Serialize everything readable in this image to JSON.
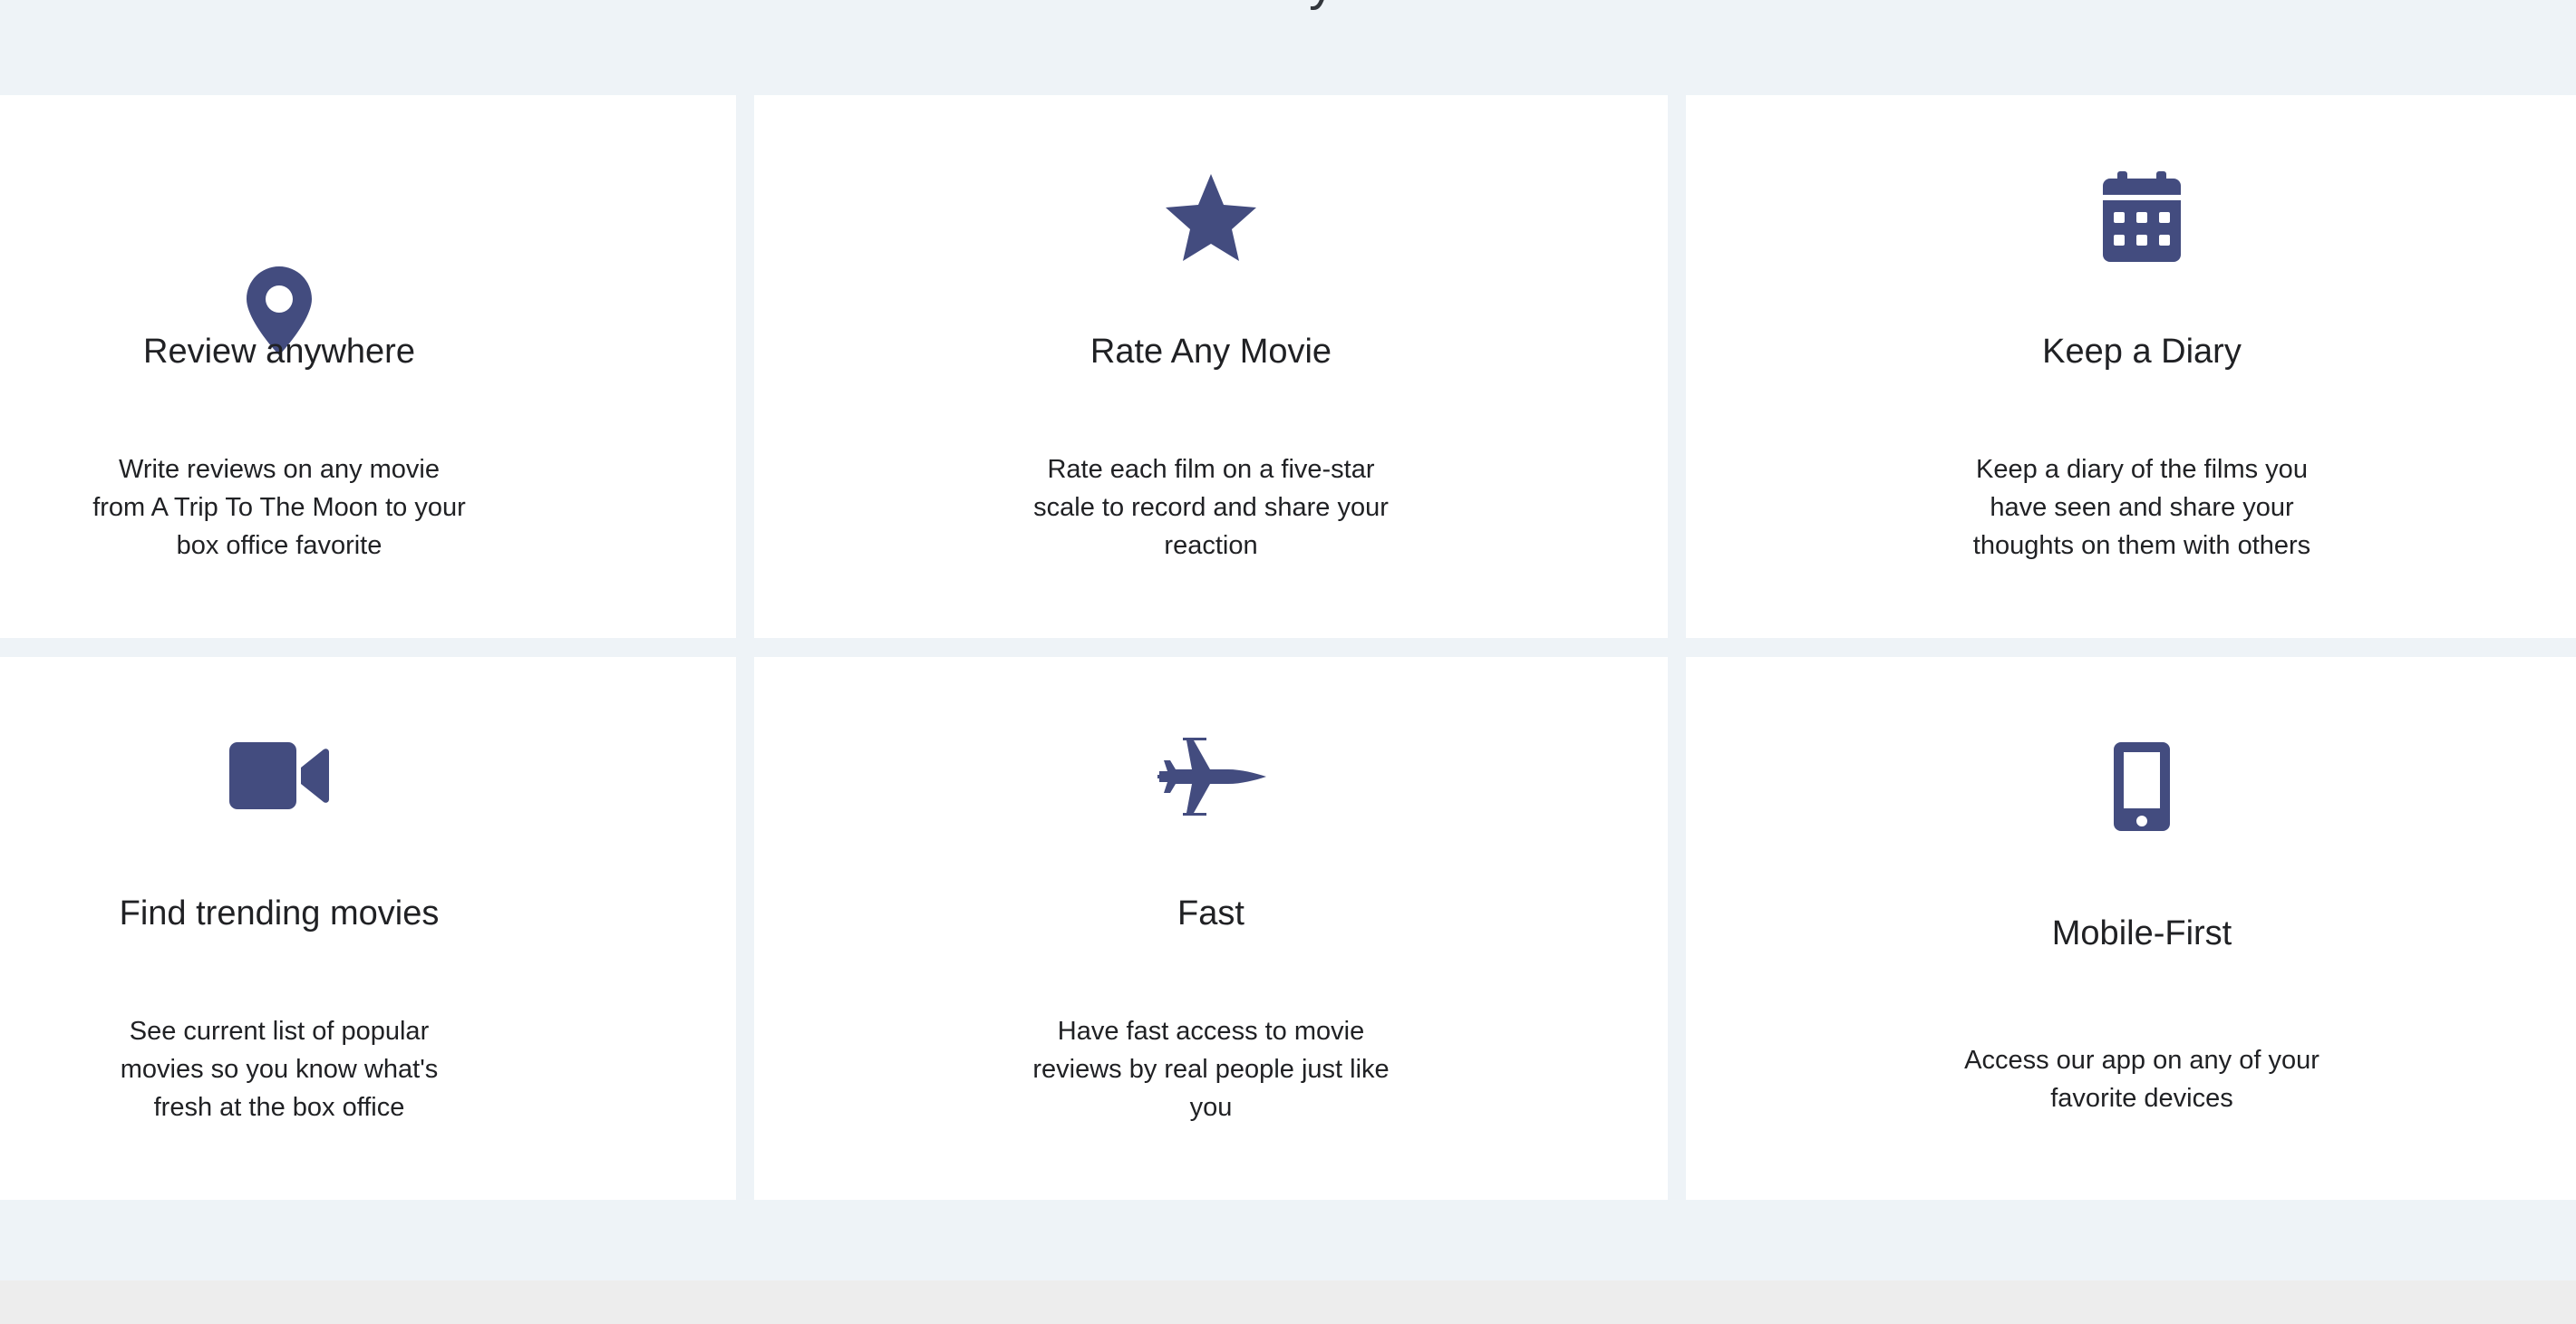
{
  "section": {
    "heading": "One Trell lets you...",
    "features": [
      {
        "icon": "map-marker-icon",
        "title": "Review anywhere",
        "description": "Write reviews on any movie from A Trip To The Moon to your box office favorite"
      },
      {
        "icon": "star-icon",
        "title": "Rate Any Movie",
        "description": "Rate each film on a five-star scale to record and share your reaction"
      },
      {
        "icon": "calendar-icon",
        "title": "Keep a Diary",
        "description": "Keep a diary of the films you have seen and share your thoughts on them with others"
      },
      {
        "icon": "video-camera-icon",
        "title": "Find trending movies",
        "description": "See current list of popular movies so you know what's fresh at the box office"
      },
      {
        "icon": "fighter-jet-icon",
        "title": "Fast",
        "description": "Have fast access to movie reviews by real people just like you"
      },
      {
        "icon": "mobile-phone-icon",
        "title": "Mobile-First",
        "description": "Access our app on any of your favorite devices"
      }
    ]
  },
  "colors": {
    "section_background": "#eef3f7",
    "card_background": "#ffffff",
    "icon": "#434c7f",
    "footer_strip": "#ededed"
  }
}
